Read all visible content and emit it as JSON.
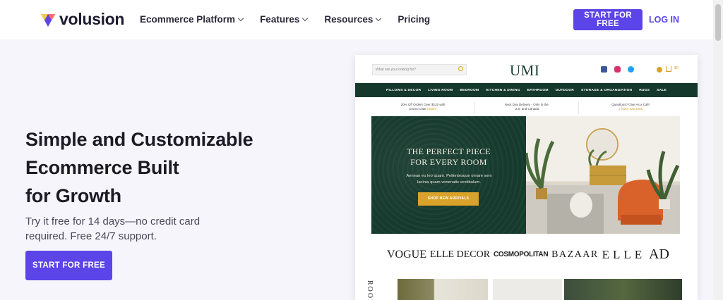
{
  "nav": {
    "logo_text": "volusion",
    "menu": [
      {
        "label": "Ecommerce Platform",
        "has_dropdown": true
      },
      {
        "label": "Features",
        "has_dropdown": true
      },
      {
        "label": "Resources",
        "has_dropdown": true
      },
      {
        "label": "Pricing",
        "has_dropdown": false
      }
    ],
    "cta_label": "START FOR FREE",
    "login_label": "LOG IN"
  },
  "hero": {
    "title_lines": [
      "Simple and Customizable",
      "Ecommerce Built",
      "for Growth"
    ],
    "subtitle_lines": [
      "Try it free for 14 days—no credit card",
      "required. Free 24/7 support."
    ],
    "cta_label": "START FOR FREE"
  },
  "mockup": {
    "search_placeholder": "What are you looking for?",
    "store_logo": "UMI",
    "cart_count": "$0",
    "categories": [
      "PILLOWS & DECOR",
      "LIVING ROOM",
      "BEDROOM",
      "KITCHEN & DINING",
      "BATHROOM",
      "OUTDOOR",
      "STORAGE & ORGANIZATION",
      "RUGS",
      "SALE"
    ],
    "promos": [
      {
        "line1": "20% Off Orders Over $120 with",
        "line2_prefix": "promo code ",
        "line2_highlight": "UMI20"
      },
      {
        "line1": "Next Day Delivery - Only in the",
        "line2_prefix": "U.S. and Canada",
        "line2_highlight": ""
      },
      {
        "line1": "Questions? Give As a Call!",
        "line2_prefix": "",
        "line2_highlight": "1 (800) 123 4566"
      }
    ],
    "hero_title_lines": [
      "THE PERFECT PIECE",
      "FOR EVERY ROOM"
    ],
    "hero_text_lines": [
      "Aenean eu leo quam. Pellentesque ornare sem",
      "lacinia quam venenatis vestibulum."
    ],
    "hero_button": "SHOP NEW ARRIVALS",
    "press": [
      "VOGUE",
      "ELLE DECOR",
      "COSMOPOLITAN",
      "BAZAAR",
      "ELLE",
      "AD"
    ],
    "bottom_label": "ROOM"
  },
  "colors": {
    "brand_purple": "#5b45e8",
    "umi_green": "#15382d",
    "umi_gold": "#d9a22a",
    "page_bg": "#f6f5fb"
  }
}
